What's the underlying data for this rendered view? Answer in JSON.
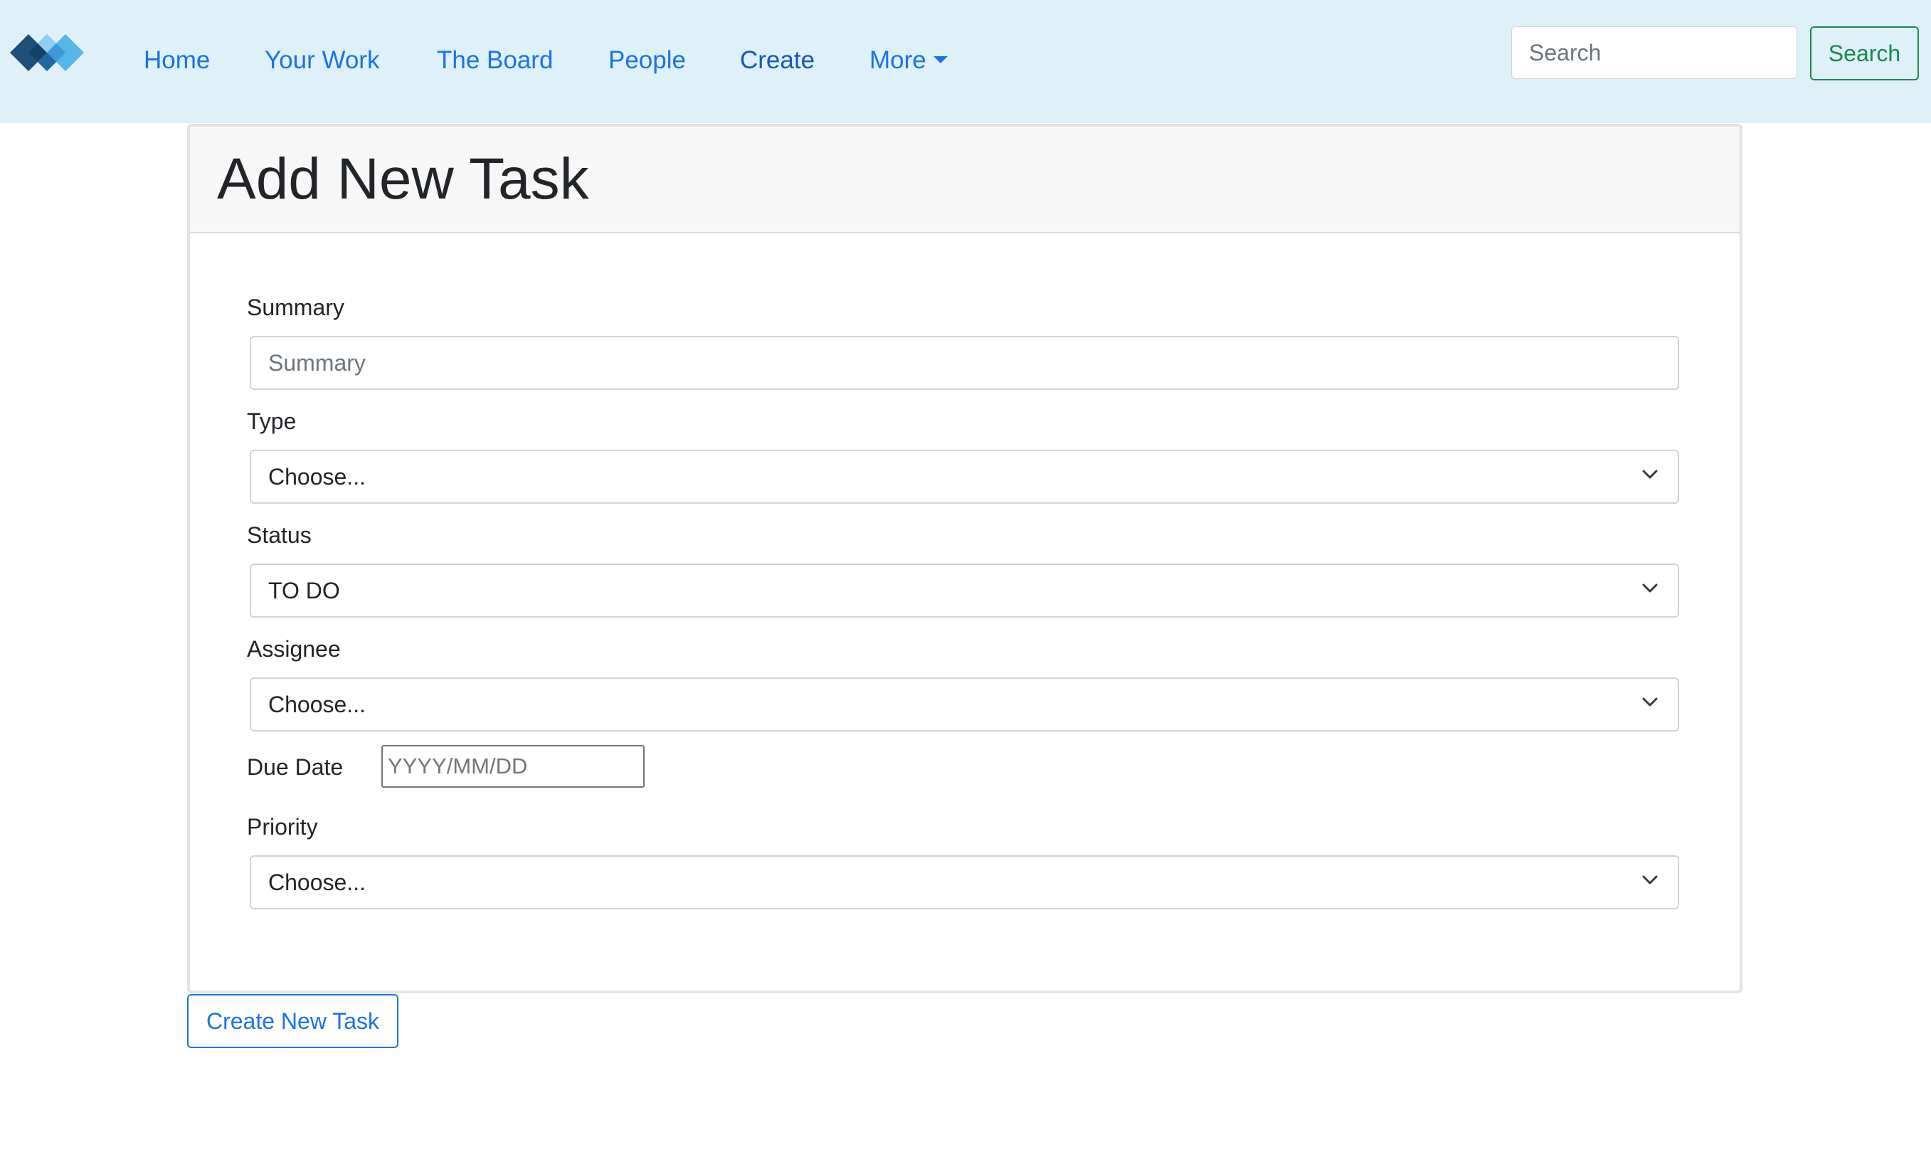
{
  "navbar": {
    "logo_icon": "diamond-logo-icon",
    "links": [
      {
        "label": "Home"
      },
      {
        "label": "Your Work"
      },
      {
        "label": "The Board"
      },
      {
        "label": "People"
      },
      {
        "label": "Create"
      },
      {
        "label": "More"
      }
    ],
    "search": {
      "placeholder": "Search",
      "value": "",
      "button_label": "Search"
    },
    "colors": {
      "background": "#dff1f8",
      "link": "#1a73e8",
      "search_button": "#198754"
    }
  },
  "card": {
    "title": "Add New Task"
  },
  "form": {
    "summary": {
      "label": "Summary",
      "placeholder": "Summary",
      "value": ""
    },
    "type": {
      "label": "Type",
      "selected": "Choose..."
    },
    "status": {
      "label": "Status",
      "selected": "TO DO"
    },
    "assignee": {
      "label": "Assignee",
      "selected": "Choose..."
    },
    "due_date": {
      "label": "Due Date",
      "placeholder": "YYYY/MM/DD",
      "value": ""
    },
    "priority": {
      "label": "Priority",
      "selected": "Choose..."
    },
    "submit_label": "Create New Task"
  }
}
